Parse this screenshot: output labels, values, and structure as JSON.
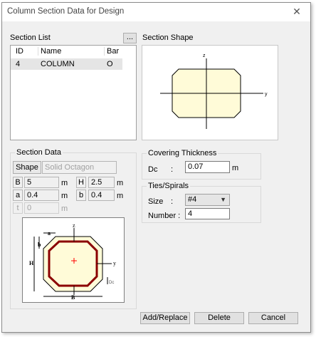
{
  "window": {
    "title": "Column Section Data for Design",
    "close_glyph": "✕"
  },
  "section_list": {
    "label": "Section List",
    "browse_label": "...",
    "columns": [
      "ID",
      "Name",
      "Bar"
    ],
    "rows": [
      {
        "id": "4",
        "name": "COLUMN",
        "bar": "O"
      }
    ]
  },
  "section_shape": {
    "label": "Section Shape",
    "z_axis": "z",
    "y_axis": "y"
  },
  "section_data": {
    "label": "Section Data",
    "shape_label": "Shape",
    "shape_value": "Solid Octagon",
    "B": {
      "label": "B",
      "value": "5",
      "unit": "m"
    },
    "H": {
      "label": "H",
      "value": "2.5",
      "unit": "m"
    },
    "a": {
      "label": "a",
      "value": "0.4",
      "unit": "m"
    },
    "b": {
      "label": "b",
      "value": "0.4",
      "unit": "m"
    },
    "t": {
      "label": "t",
      "value": "0",
      "unit": "m"
    }
  },
  "diagram": {
    "a": "a",
    "b": "b",
    "z": "z",
    "y": "y",
    "H": "H",
    "B": "B",
    "Dc": "Dc"
  },
  "covering": {
    "label": "Covering Thickness",
    "dc_label": "Dc",
    "colon": ":",
    "dc_value": "0.07",
    "unit": "m"
  },
  "ties": {
    "label": "Ties/Spirals",
    "size_label": "Size",
    "colon": ":",
    "size_value": "#4",
    "number_label": "Number :",
    "number_value": "4"
  },
  "buttons": {
    "add": "Add/Replace",
    "delete": "Delete",
    "cancel": "Cancel"
  },
  "colors": {
    "shape_fill": "#fffbd8",
    "rebar_ring": "#8b0000",
    "centroid": "#ff0000"
  }
}
